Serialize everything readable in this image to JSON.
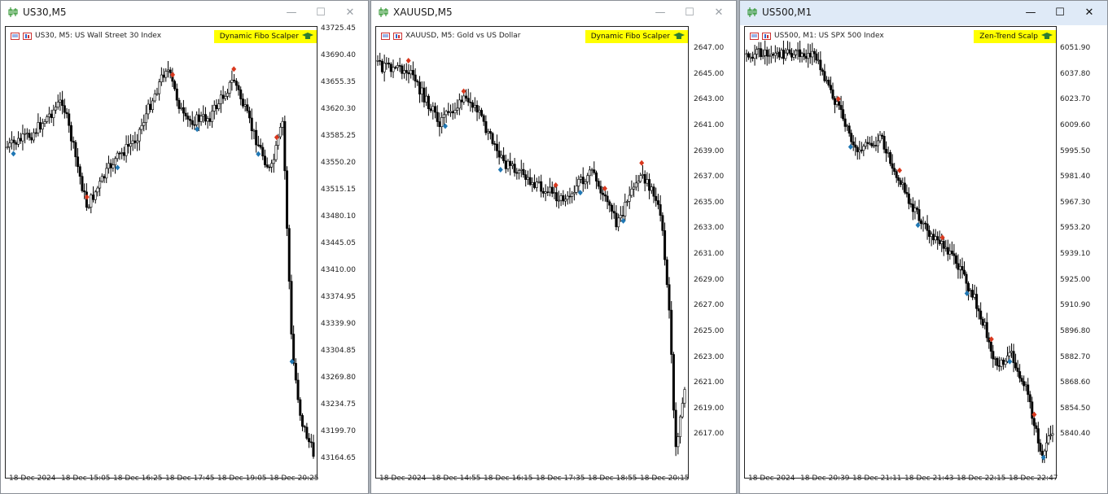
{
  "windows": [
    {
      "id": "us30",
      "title": "US30,M5",
      "symbol_info": "US30, M5:  US Wall Street 30 Index",
      "indicator": "Dynamic Fibo Scalper",
      "active": false,
      "y_ticks": [
        "43725.45",
        "43690.40",
        "43655.35",
        "43620.30",
        "43585.25",
        "43550.20",
        "43515.15",
        "43480.10",
        "43445.05",
        "43410.00",
        "43374.95",
        "43339.90",
        "43304.85",
        "43269.80",
        "43234.75",
        "43199.70",
        "43164.65"
      ],
      "x_ticks": [
        "18 Dec 2024",
        "18 Dec 15:05",
        "18 Dec 16:25",
        "18 Dec 17:45",
        "18 Dec 19:05",
        "18 Dec 20:25"
      ]
    },
    {
      "id": "xauusd",
      "title": "XAUUSD,M5",
      "symbol_info": "XAUUSD, M5:  Gold vs US Dollar",
      "indicator": "Dynamic Fibo Scalper",
      "active": false,
      "y_ticks": [
        "2647.00",
        "2645.00",
        "2643.00",
        "2641.00",
        "2639.00",
        "2637.00",
        "2635.00",
        "2633.00",
        "2631.00",
        "2629.00",
        "2627.00",
        "2625.00",
        "2623.00",
        "2621.00",
        "2619.00",
        "2617.00"
      ],
      "x_ticks": [
        "18 Dec 2024",
        "18 Dec 14:55",
        "18 Dec 16:15",
        "18 Dec 17:35",
        "18 Dec 18:55",
        "18 Dec 20:15"
      ]
    },
    {
      "id": "us500",
      "title": "US500,M1",
      "symbol_info": "US500, M1:  US SPX 500 Index",
      "indicator": "Zen-Trend Scalp",
      "active": true,
      "y_ticks": [
        "6051.90",
        "6037.80",
        "6023.70",
        "6009.60",
        "5995.50",
        "5981.40",
        "5967.30",
        "5953.20",
        "5939.10",
        "5925.00",
        "5910.90",
        "5896.80",
        "5882.70",
        "5868.60",
        "5854.50",
        "5840.40"
      ],
      "x_ticks": [
        "18 Dec 2024",
        "18 Dec 20:39",
        "18 Dec 21:11",
        "18 Dec 21:43",
        "18 Dec 22:15",
        "18 Dec 22:47"
      ]
    }
  ],
  "window_buttons": {
    "minimize": "—",
    "maximize": "☐",
    "close": "✕"
  },
  "colors": {
    "buy_arrow": "#1f77b4",
    "sell_arrow": "#d9381e",
    "badge": "#ffff00",
    "candle": "#000000",
    "active_title": "#dfeaf7"
  },
  "icons": {
    "title": "candlestick-chart-icon",
    "badge": "graduation-cap-icon"
  }
}
